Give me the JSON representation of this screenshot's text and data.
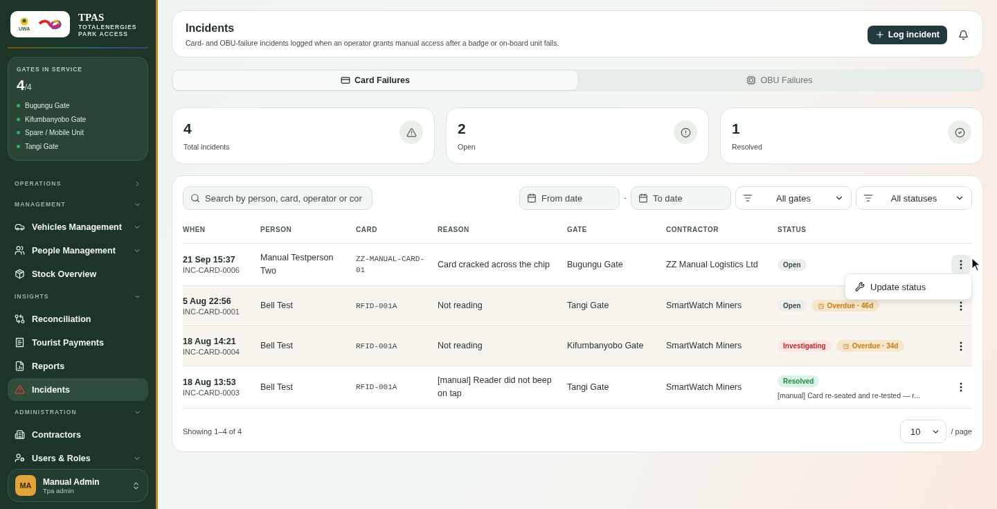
{
  "brand": {
    "logo_caption": "UWA",
    "title": "TPAS",
    "subtitle_lines": [
      "TOTALENERGIES",
      "PARK ACCESS"
    ]
  },
  "gates_card": {
    "label": "GATES IN SERVICE",
    "count": "4",
    "total": "/4",
    "gates": [
      "Bugungu Gate",
      "Kifumbanyobo Gate",
      "Spare / Mobile Unit",
      "Tangi Gate"
    ]
  },
  "nav": [
    {
      "title": "OPERATIONS",
      "expanded": false
    },
    {
      "title": "MANAGEMENT",
      "expanded": true,
      "items": [
        {
          "label": "Vehicles Management",
          "selected": false,
          "expandable": true
        },
        {
          "label": "People Management",
          "selected": false,
          "expandable": true
        },
        {
          "label": "Stock Overview",
          "selected": false,
          "expandable": false
        }
      ]
    },
    {
      "title": "INSIGHTS",
      "expanded": true,
      "items": [
        {
          "label": "Reconciliation",
          "selected": false,
          "expandable": false
        },
        {
          "label": "Tourist Payments",
          "selected": false,
          "expandable": false
        },
        {
          "label": "Reports",
          "selected": false,
          "expandable": false
        },
        {
          "label": "Incidents",
          "selected": true,
          "expandable": false
        }
      ]
    },
    {
      "title": "ADMINISTRATION",
      "expanded": true,
      "items": [
        {
          "label": "Contractors",
          "selected": false,
          "expandable": false
        },
        {
          "label": "Users & Roles",
          "selected": false,
          "expandable": true
        }
      ]
    }
  ],
  "user": {
    "initials": "MA",
    "name": "Manual Admin",
    "role": "Tpa admin"
  },
  "header": {
    "title": "Incidents",
    "description": "Card- and OBU-failure incidents logged when an operator grants manual access after a badge or on-board unit fails.",
    "action": "Log incident"
  },
  "tabs": [
    {
      "label": "Card Failures",
      "selected": true
    },
    {
      "label": "OBU Failures",
      "selected": false
    }
  ],
  "stats": [
    {
      "value": "4",
      "label": "Total incidents"
    },
    {
      "value": "2",
      "label": "Open"
    },
    {
      "value": "1",
      "label": "Resolved"
    }
  ],
  "filters": {
    "search_placeholder": "Search by person, card, operator or cor",
    "from_placeholder": "From date",
    "separator": "-",
    "to_placeholder": "To date",
    "gate": "All gates",
    "status": "All statuses"
  },
  "table": {
    "columns": [
      "WHEN",
      "PERSON",
      "CARD",
      "REASON",
      "GATE",
      "CONTRACTOR",
      "STATUS"
    ],
    "rows": [
      {
        "when": "21 Sep 15:37",
        "id": "INC-CARD-0006",
        "person": "Manual Testperson Two",
        "card": "ZZ-MANUAL-CARD-01",
        "reason": "Card cracked across the chip",
        "gate": "Bugungu Gate",
        "contractor": "ZZ Manual Logistics Ltd",
        "status": {
          "label": "Open",
          "kind": "open"
        },
        "overdue": null,
        "note": null,
        "menu_open": true,
        "menu_items": [
          "Update status"
        ]
      },
      {
        "when": "5 Aug 22:56",
        "id": "INC-CARD-0001",
        "person": "Bell Test",
        "card": "RFID-001A",
        "reason": "Not reading",
        "gate": "Tangi Gate",
        "contractor": "SmartWatch Miners",
        "status": {
          "label": "Open",
          "kind": "open"
        },
        "overdue": "Overdue · 46d",
        "note": null,
        "menu_open": false
      },
      {
        "when": "18 Aug 14:21",
        "id": "INC-CARD-0004",
        "person": "Bell Test",
        "card": "RFID-001A",
        "reason": "Not reading",
        "gate": "Kifumbanyobo Gate",
        "contractor": "SmartWatch Miners",
        "status": {
          "label": "Investigating",
          "kind": "investigating"
        },
        "overdue": "Overdue · 34d",
        "note": null,
        "menu_open": false
      },
      {
        "when": "18 Aug 13:53",
        "id": "INC-CARD-0003",
        "person": "Bell Test",
        "card": "RFID-001A",
        "reason": "[manual] Reader did not beep on tap",
        "gate": "Tangi Gate",
        "contractor": "SmartWatch Miners",
        "status": {
          "label": "Resolved",
          "kind": "resolved"
        },
        "overdue": null,
        "note": "[manual] Card re-seated and re-tested — r...",
        "menu_open": false
      }
    ]
  },
  "footer": {
    "showing": "Showing 1–4 of 4",
    "page_size": "10",
    "per_page": "/ page"
  }
}
